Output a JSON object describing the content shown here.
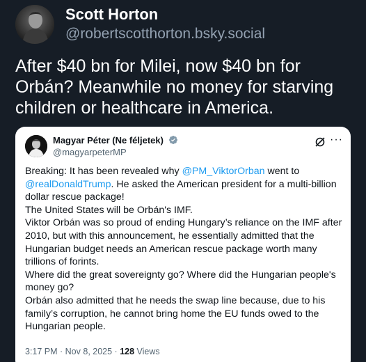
{
  "post": {
    "author_name": "Scott Horton",
    "author_handle": "@robertscotthorton.bsky.social",
    "text_lines": [
      "After $40 bn for Milei, now $40 bn for",
      "Orbán? Meanwhile no money for starving",
      "children or healthcare in America."
    ]
  },
  "quoted": {
    "author_name": "Magyar Péter (Ne féljetek)",
    "author_handle": "@magyarpeterMP",
    "body": {
      "l1_pre": "Breaking: It has been revealed why ",
      "l1_mention": "@PM_ViktorOrban",
      "l1_post": " went to",
      "l2_mention": "@realDonaldTrump",
      "l2_post": ". He asked the American president for a multi-billion",
      "l3": "dollar rescue package!",
      "l4": "The United States will be Orbán's IMF.",
      "l5": "Viktor Orbán was so proud of ending Hungary’s reliance on the IMF after",
      "l6": "2010, but with this announcement, he essentially admitted that the",
      "l7": "Hungarian budget needs an American rescue package worth many",
      "l8": "trillions of forints.",
      "l9": "Where did the great sovereignty go? Where did the Hungarian people's",
      "l10": "money go?",
      "l11": "Orbán also admitted that he needs the swap line because, due to his",
      "l12": "family’s corruption, he cannot bring home the EU funds owed to the",
      "l13": "Hungarian people."
    },
    "timestamp": "3:17 PM · Nov 8, 2025 · ",
    "views_count": "128",
    "views_label": " Views",
    "more_glyph": "···"
  },
  "icons": {
    "verified": "verified-badge-icon",
    "grok": "grok-icon",
    "more": "more-options-icon"
  },
  "colors": {
    "background": "#161d26",
    "handle": "#93a1b1",
    "mention": "#1d9bf0",
    "card": "#ffffff"
  }
}
